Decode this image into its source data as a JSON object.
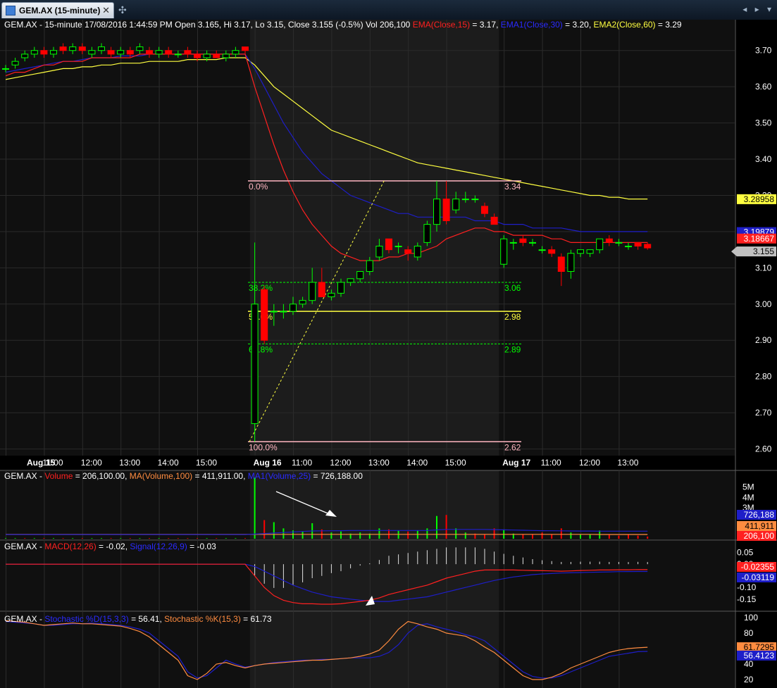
{
  "window": {
    "tab_title": "GEM.AX (15-minute)",
    "close_glyph": "✕",
    "newtab_glyph": "✣",
    "nav_glyphs": "◂ ▸ ▾"
  },
  "colors": {
    "bg": "#000000",
    "panel_alt": "#1a1a1a",
    "grid": "#3a3a3a",
    "up": "#00ff00",
    "down": "#ff0000",
    "ema": "#ff2020",
    "ema1": "#1e1ec8",
    "ema2": "#ffff40",
    "fib_white": "#ffb6c1",
    "fib_green": "#00ff00",
    "fib_yellow": "#ffff40"
  },
  "price_panel": {
    "header": [
      {
        "text": "GEM.AX - 15-minute 17/08/2016 1:44:59 PM Open 3.165, Hi 3.17, Lo 3.15, Close 3.155 (-0.5%) Vol 206,100 ",
        "color": "#ffffff"
      },
      {
        "text": "EMA(Close,15)",
        "color": "#ff2020"
      },
      {
        "text": " = 3.17, ",
        "color": "#ffffff"
      },
      {
        "text": "EMA1(Close,30)",
        "color": "#2a2aff"
      },
      {
        "text": " = 3.20, ",
        "color": "#ffffff"
      },
      {
        "text": "EMA2(Close,60)",
        "color": "#ffff40"
      },
      {
        "text": " = 3.29",
        "color": "#ffffff"
      }
    ],
    "y_ticks": [
      "2.60",
      "2.70",
      "2.80",
      "2.90",
      "3.00",
      "3.10",
      "3.20",
      "3.30",
      "3.40",
      "3.50",
      "3.60",
      "3.70"
    ],
    "last_labels": [
      {
        "value": "3.28958",
        "bg": "#ffff40",
        "fg": "#000000"
      },
      {
        "value": "3.19879",
        "bg": "#1e1ec8",
        "fg": "#ffffff"
      },
      {
        "value": "3.18667",
        "bg": "#ff2020",
        "fg": "#ffffff"
      },
      {
        "value": "3.155",
        "bg": "#c0c0c0",
        "fg": "#000000"
      }
    ],
    "fib": [
      {
        "pct": "0.0%",
        "value": "3.34",
        "color": "#ffb6c1",
        "style": "solid"
      },
      {
        "pct": "38.2%",
        "value": "3.06",
        "color": "#00ff00",
        "style": "dashed"
      },
      {
        "pct": "50.0%",
        "value": "2.98",
        "color": "#ffff40",
        "style": "solid"
      },
      {
        "pct": "61.8%",
        "value": "2.89",
        "color": "#00ff00",
        "style": "dashed"
      },
      {
        "pct": "100.0%",
        "value": "2.62",
        "color": "#ffb6c1",
        "style": "solid"
      }
    ]
  },
  "x_axis": [
    {
      "label": "Aug 15",
      "bold": true
    },
    {
      "label": "11:00",
      "bold": false
    },
    {
      "label": "12:00",
      "bold": false
    },
    {
      "label": "13:00",
      "bold": false
    },
    {
      "label": "14:00",
      "bold": false
    },
    {
      "label": "15:00",
      "bold": false
    },
    {
      "label": "Aug 16",
      "bold": true
    },
    {
      "label": "11:00",
      "bold": false
    },
    {
      "label": "12:00",
      "bold": false
    },
    {
      "label": "13:00",
      "bold": false
    },
    {
      "label": "14:00",
      "bold": false
    },
    {
      "label": "15:00",
      "bold": false
    },
    {
      "label": "Aug 17",
      "bold": true
    },
    {
      "label": "11:00",
      "bold": false
    },
    {
      "label": "12:00",
      "bold": false
    },
    {
      "label": "13:00",
      "bold": false
    }
  ],
  "volume_panel": {
    "header": [
      {
        "text": "GEM.AX - ",
        "color": "#ffffff"
      },
      {
        "text": "Volume",
        "color": "#ff2020"
      },
      {
        "text": " = 206,100.00, ",
        "color": "#ffffff"
      },
      {
        "text": "MA(Volume,100)",
        "color": "#ff8c40"
      },
      {
        "text": " = 411,911.00, ",
        "color": "#ffffff"
      },
      {
        "text": "MA1(Volume,25)",
        "color": "#2a2aff"
      },
      {
        "text": " = 726,188.00",
        "color": "#ffffff"
      }
    ],
    "y_ticks": [
      "3M",
      "4M",
      "5M"
    ],
    "last_labels": [
      {
        "value": "726,188",
        "bg": "#1e1ec8",
        "fg": "#ffffff"
      },
      {
        "value": "411,911",
        "bg": "#ff8c40",
        "fg": "#000000"
      },
      {
        "value": "206,100",
        "bg": "#ff2020",
        "fg": "#ffffff"
      }
    ]
  },
  "macd_panel": {
    "header": [
      {
        "text": "GEM.AX - ",
        "color": "#ffffff"
      },
      {
        "text": "MACD(12,26)",
        "color": "#ff2020"
      },
      {
        "text": " = -0.02, ",
        "color": "#ffffff"
      },
      {
        "text": "Signal(12,26,9)",
        "color": "#2a2aff"
      },
      {
        "text": " = -0.03",
        "color": "#ffffff"
      }
    ],
    "y_ticks": [
      "0.05",
      "0.00",
      "-0.05",
      "-0.10",
      "-0.15"
    ],
    "last_labels": [
      {
        "value": "-0.02355",
        "bg": "#ff2020",
        "fg": "#ffffff"
      },
      {
        "value": "-0.03119",
        "bg": "#1e1ec8",
        "fg": "#ffffff"
      }
    ]
  },
  "stoch_panel": {
    "header": [
      {
        "text": "GEM.AX - ",
        "color": "#ffffff"
      },
      {
        "text": "Stochastic %D(15,3,3)",
        "color": "#2a2aff"
      },
      {
        "text": " = 56.41, ",
        "color": "#ffffff"
      },
      {
        "text": "Stochastic %K(15,3)",
        "color": "#ff8c40"
      },
      {
        "text": " = 61.73",
        "color": "#ffffff"
      }
    ],
    "y_ticks": [
      "20",
      "40",
      "60",
      "80",
      "100"
    ],
    "last_labels": [
      {
        "value": "61.7295",
        "bg": "#ff8c40",
        "fg": "#000000"
      },
      {
        "value": "56.4123",
        "bg": "#1e1ec8",
        "fg": "#ffffff"
      }
    ]
  },
  "chart_data": {
    "type": "candlestick",
    "symbol": "GEM.AX",
    "interval": "15-minute",
    "ylim": [
      2.57,
      3.75
    ],
    "candles": [
      [
        3.65,
        3.66,
        3.64,
        3.65
      ],
      [
        3.66,
        3.68,
        3.65,
        3.67
      ],
      [
        3.68,
        3.7,
        3.67,
        3.69
      ],
      [
        3.69,
        3.71,
        3.68,
        3.7
      ],
      [
        3.7,
        3.71,
        3.68,
        3.69
      ],
      [
        3.69,
        3.71,
        3.68,
        3.7
      ],
      [
        3.71,
        3.72,
        3.69,
        3.7
      ],
      [
        3.7,
        3.72,
        3.69,
        3.71
      ],
      [
        3.71,
        3.72,
        3.69,
        3.7
      ],
      [
        3.69,
        3.71,
        3.68,
        3.7
      ],
      [
        3.7,
        3.72,
        3.69,
        3.71
      ],
      [
        3.7,
        3.71,
        3.68,
        3.69
      ],
      [
        3.69,
        3.71,
        3.68,
        3.7
      ],
      [
        3.7,
        3.71,
        3.68,
        3.69
      ],
      [
        3.7,
        3.72,
        3.69,
        3.71
      ],
      [
        3.7,
        3.71,
        3.68,
        3.69
      ],
      [
        3.69,
        3.71,
        3.68,
        3.7
      ],
      [
        3.7,
        3.71,
        3.68,
        3.69
      ],
      [
        3.69,
        3.7,
        3.68,
        3.69
      ],
      [
        3.7,
        3.71,
        3.68,
        3.69
      ],
      [
        3.69,
        3.7,
        3.67,
        3.68
      ],
      [
        3.68,
        3.7,
        3.67,
        3.69
      ],
      [
        3.69,
        3.7,
        3.68,
        3.68
      ],
      [
        3.68,
        3.7,
        3.67,
        3.69
      ],
      [
        3.69,
        3.71,
        3.68,
        3.7
      ],
      [
        3.71,
        3.71,
        3.69,
        3.7
      ],
      [
        2.67,
        3.17,
        2.62,
        3.0
      ],
      [
        3.04,
        3.05,
        2.89,
        2.9
      ],
      [
        2.98,
        3.0,
        2.94,
        2.98
      ],
      [
        2.98,
        3.0,
        2.96,
        2.98
      ],
      [
        2.98,
        3.02,
        2.97,
        3.0
      ],
      [
        3.0,
        3.02,
        2.99,
        3.01
      ],
      [
        3.01,
        3.1,
        3.0,
        3.06
      ],
      [
        3.06,
        3.1,
        3.02,
        3.02
      ],
      [
        3.02,
        3.04,
        3.01,
        3.03
      ],
      [
        3.03,
        3.07,
        3.02,
        3.06
      ],
      [
        3.06,
        3.07,
        3.05,
        3.07
      ],
      [
        3.07,
        3.09,
        3.06,
        3.09
      ],
      [
        3.09,
        3.13,
        3.08,
        3.12
      ],
      [
        3.13,
        3.18,
        3.12,
        3.16
      ],
      [
        3.18,
        3.18,
        3.14,
        3.15
      ],
      [
        3.16,
        3.17,
        3.14,
        3.16
      ],
      [
        3.15,
        3.16,
        3.12,
        3.14
      ],
      [
        3.13,
        3.17,
        3.12,
        3.16
      ],
      [
        3.17,
        3.23,
        3.16,
        3.22
      ],
      [
        3.22,
        3.34,
        3.2,
        3.29
      ],
      [
        3.29,
        3.34,
        3.22,
        3.23
      ],
      [
        3.26,
        3.31,
        3.25,
        3.29
      ],
      [
        3.29,
        3.31,
        3.28,
        3.29
      ],
      [
        3.29,
        3.3,
        3.28,
        3.29
      ],
      [
        3.27,
        3.28,
        3.24,
        3.25
      ],
      [
        3.24,
        3.25,
        3.22,
        3.22
      ],
      [
        3.11,
        3.19,
        3.1,
        3.18
      ],
      [
        3.17,
        3.18,
        3.15,
        3.17
      ],
      [
        3.18,
        3.19,
        3.16,
        3.17
      ],
      [
        3.17,
        3.18,
        3.16,
        3.17
      ],
      [
        3.15,
        3.16,
        3.14,
        3.15
      ],
      [
        3.15,
        3.16,
        3.13,
        3.14
      ],
      [
        3.13,
        3.14,
        3.05,
        3.09
      ],
      [
        3.09,
        3.15,
        3.07,
        3.14
      ],
      [
        3.14,
        3.15,
        3.13,
        3.15
      ],
      [
        3.14,
        3.15,
        3.13,
        3.15
      ],
      [
        3.15,
        3.18,
        3.14,
        3.18
      ],
      [
        3.18,
        3.19,
        3.16,
        3.17
      ],
      [
        3.17,
        3.18,
        3.16,
        3.17
      ],
      [
        3.16,
        3.17,
        3.15,
        3.16
      ],
      [
        3.17,
        3.17,
        3.15,
        3.16
      ],
      [
        3.165,
        3.17,
        3.15,
        3.155
      ]
    ],
    "ema15": [
      3.63,
      3.64,
      3.64,
      3.65,
      3.66,
      3.66,
      3.67,
      3.67,
      3.67,
      3.68,
      3.68,
      3.68,
      3.68,
      3.68,
      3.69,
      3.69,
      3.69,
      3.69,
      3.69,
      3.69,
      3.69,
      3.69,
      3.69,
      3.69,
      3.69,
      3.69,
      3.6,
      3.52,
      3.44,
      3.37,
      3.31,
      3.26,
      3.22,
      3.19,
      3.16,
      3.14,
      3.13,
      3.12,
      3.12,
      3.12,
      3.13,
      3.13,
      3.14,
      3.14,
      3.15,
      3.16,
      3.18,
      3.19,
      3.2,
      3.21,
      3.21,
      3.2,
      3.2,
      3.19,
      3.19,
      3.19,
      3.19,
      3.18,
      3.18,
      3.17,
      3.17,
      3.17,
      3.17,
      3.17,
      3.17,
      3.17,
      3.17,
      3.17
    ],
    "ema30": [
      3.64,
      3.645,
      3.65,
      3.655,
      3.66,
      3.665,
      3.67,
      3.67,
      3.675,
      3.68,
      3.68,
      3.68,
      3.685,
      3.685,
      3.685,
      3.69,
      3.69,
      3.69,
      3.69,
      3.69,
      3.69,
      3.69,
      3.69,
      3.69,
      3.69,
      3.69,
      3.65,
      3.6,
      3.55,
      3.5,
      3.46,
      3.42,
      3.39,
      3.36,
      3.34,
      3.32,
      3.3,
      3.29,
      3.28,
      3.27,
      3.26,
      3.25,
      3.25,
      3.24,
      3.24,
      3.24,
      3.24,
      3.24,
      3.24,
      3.23,
      3.23,
      3.23,
      3.22,
      3.22,
      3.22,
      3.21,
      3.21,
      3.21,
      3.21,
      3.205,
      3.2,
      3.2,
      3.2,
      3.2,
      3.2,
      3.2,
      3.2,
      3.2
    ],
    "ema60": [
      3.62,
      3.625,
      3.63,
      3.635,
      3.64,
      3.645,
      3.65,
      3.65,
      3.655,
      3.655,
      3.66,
      3.66,
      3.665,
      3.665,
      3.665,
      3.67,
      3.67,
      3.67,
      3.67,
      3.675,
      3.675,
      3.675,
      3.675,
      3.68,
      3.68,
      3.68,
      3.66,
      3.63,
      3.6,
      3.58,
      3.56,
      3.54,
      3.52,
      3.5,
      3.48,
      3.47,
      3.46,
      3.45,
      3.44,
      3.43,
      3.42,
      3.41,
      3.4,
      3.39,
      3.385,
      3.38,
      3.375,
      3.37,
      3.365,
      3.36,
      3.355,
      3.35,
      3.345,
      3.34,
      3.335,
      3.33,
      3.325,
      3.32,
      3.315,
      3.31,
      3.305,
      3.3,
      3.3,
      3.295,
      3.295,
      3.29,
      3.29,
      3.29
    ],
    "volume": [
      0.05,
      0.05,
      0.05,
      0.05,
      0.05,
      0.05,
      0.05,
      0.05,
      0.05,
      0.05,
      0.05,
      0.05,
      0.05,
      0.05,
      0.05,
      0.05,
      0.05,
      0.05,
      0.05,
      0.05,
      0.05,
      0.05,
      0.05,
      0.05,
      0.05,
      0.05,
      5.9,
      1.8,
      1.6,
      1.0,
      0.8,
      0.7,
      1.5,
      0.9,
      0.6,
      0.7,
      0.5,
      0.6,
      0.5,
      1.0,
      0.9,
      0.8,
      0.7,
      0.8,
      1.0,
      2.2,
      2.3,
      1.0,
      0.6,
      0.5,
      0.4,
      1.0,
      0.9,
      0.5,
      0.4,
      0.4,
      0.6,
      0.4,
      1.0,
      0.6,
      0.4,
      0.4,
      0.8,
      0.4,
      0.3,
      0.4,
      0.3,
      0.21
    ],
    "volume_up": [
      1,
      1,
      0,
      1,
      0,
      1,
      0,
      1,
      0,
      1,
      1,
      0,
      1,
      0,
      1,
      0,
      1,
      0,
      0,
      0,
      0,
      1,
      0,
      1,
      1,
      0,
      1,
      0,
      1,
      1,
      1,
      1,
      1,
      0,
      1,
      1,
      1,
      1,
      1,
      1,
      0,
      1,
      0,
      1,
      1,
      1,
      0,
      1,
      1,
      0,
      0,
      0,
      1,
      1,
      0,
      0,
      0,
      0,
      0,
      1,
      1,
      1,
      1,
      0,
      0,
      0,
      0,
      0
    ],
    "vol_ma25": [
      0.4,
      0.4,
      0.4,
      0.4,
      0.4,
      0.4,
      0.4,
      0.4,
      0.4,
      0.4,
      0.4,
      0.4,
      0.4,
      0.4,
      0.4,
      0.4,
      0.4,
      0.4,
      0.4,
      0.4,
      0.4,
      0.4,
      0.4,
      0.4,
      0.4,
      0.4,
      0.45,
      0.5,
      0.55,
      0.6,
      0.65,
      0.7,
      0.75,
      0.76,
      0.77,
      0.78,
      0.8,
      0.8,
      0.8,
      0.8,
      0.8,
      0.8,
      0.8,
      0.8,
      0.8,
      0.85,
      0.9,
      0.9,
      0.9,
      0.9,
      0.9,
      0.88,
      0.86,
      0.84,
      0.82,
      0.8,
      0.78,
      0.77,
      0.76,
      0.75,
      0.74,
      0.74,
      0.73,
      0.73,
      0.73,
      0.73,
      0.726,
      0.726
    ],
    "vol_ma100": [
      0.42,
      0.42,
      0.42,
      0.42,
      0.42,
      0.42,
      0.42,
      0.42,
      0.42,
      0.42,
      0.42,
      0.42,
      0.42,
      0.42,
      0.42,
      0.42,
      0.42,
      0.42,
      0.42,
      0.42,
      0.42,
      0.42,
      0.42,
      0.42,
      0.42,
      0.42,
      0.42,
      0.42,
      0.42,
      0.42,
      0.42,
      0.42,
      0.42,
      0.42,
      0.42,
      0.42,
      0.42,
      0.42,
      0.42,
      0.42,
      0.42,
      0.42,
      0.42,
      0.42,
      0.42,
      0.42,
      0.42,
      0.42,
      0.42,
      0.42,
      0.42,
      0.42,
      0.42,
      0.42,
      0.42,
      0.42,
      0.42,
      0.42,
      0.42,
      0.42,
      0.42,
      0.42,
      0.412,
      0.412,
      0.412,
      0.412,
      0.412,
      0.412
    ],
    "macd": [
      0.0,
      0.0,
      0.0,
      0.0,
      0.0,
      0.0,
      0.0,
      0.0,
      0.0,
      0.0,
      0.0,
      0.0,
      0.0,
      0.0,
      0.0,
      0.0,
      0.0,
      0.0,
      0.0,
      0.0,
      0.0,
      0.0,
      0.0,
      0.0,
      0.0,
      0.0,
      -0.05,
      -0.1,
      -0.135,
      -0.155,
      -0.165,
      -0.17,
      -0.17,
      -0.172,
      -0.172,
      -0.17,
      -0.165,
      -0.16,
      -0.155,
      -0.145,
      -0.13,
      -0.12,
      -0.11,
      -0.1,
      -0.09,
      -0.075,
      -0.06,
      -0.05,
      -0.04,
      -0.03,
      -0.025,
      -0.025,
      -0.025,
      -0.025,
      -0.026,
      -0.027,
      -0.028,
      -0.029,
      -0.03,
      -0.029,
      -0.027,
      -0.026,
      -0.025,
      -0.025,
      -0.024,
      -0.024,
      -0.023,
      -0.0235
    ],
    "signal": [
      0.0,
      0.0,
      0.0,
      0.0,
      0.0,
      0.0,
      0.0,
      0.0,
      0.0,
      0.0,
      0.0,
      0.0,
      0.0,
      0.0,
      0.0,
      0.0,
      0.0,
      0.0,
      0.0,
      0.0,
      0.0,
      0.0,
      0.0,
      0.0,
      0.0,
      0.0,
      -0.01,
      -0.03,
      -0.05,
      -0.07,
      -0.09,
      -0.105,
      -0.12,
      -0.13,
      -0.14,
      -0.145,
      -0.15,
      -0.155,
      -0.158,
      -0.16,
      -0.16,
      -0.155,
      -0.15,
      -0.145,
      -0.14,
      -0.13,
      -0.12,
      -0.11,
      -0.1,
      -0.09,
      -0.08,
      -0.07,
      -0.062,
      -0.055,
      -0.05,
      -0.045,
      -0.042,
      -0.04,
      -0.038,
      -0.037,
      -0.036,
      -0.035,
      -0.034,
      -0.033,
      -0.032,
      -0.0315,
      -0.0313,
      -0.0312
    ],
    "stoch_d": [
      95,
      94,
      93,
      92,
      90,
      90,
      91,
      92,
      92,
      93,
      92,
      91,
      90,
      88,
      85,
      80,
      70,
      60,
      50,
      30,
      22,
      25,
      35,
      45,
      40,
      36,
      38,
      40,
      42,
      43,
      44,
      45,
      45,
      46,
      46,
      47,
      48,
      48,
      48,
      50,
      55,
      65,
      80,
      90,
      92,
      88,
      85,
      82,
      78,
      75,
      70,
      60,
      50,
      40,
      30,
      24,
      22,
      22,
      25,
      30,
      35,
      40,
      45,
      50,
      52,
      54,
      56,
      56.4
    ],
    "stoch_k": [
      96,
      95,
      94,
      92,
      90,
      91,
      92,
      93,
      92,
      92,
      91,
      90,
      89,
      86,
      82,
      75,
      65,
      55,
      45,
      25,
      20,
      28,
      40,
      42,
      38,
      35,
      38,
      40,
      41,
      42,
      43,
      44,
      45,
      45,
      46,
      47,
      48,
      50,
      53,
      58,
      70,
      85,
      95,
      92,
      88,
      85,
      80,
      78,
      76,
      70,
      62,
      55,
      45,
      35,
      25,
      20,
      20,
      23,
      28,
      35,
      40,
      45,
      50,
      55,
      58,
      60,
      61,
      61.7
    ]
  }
}
